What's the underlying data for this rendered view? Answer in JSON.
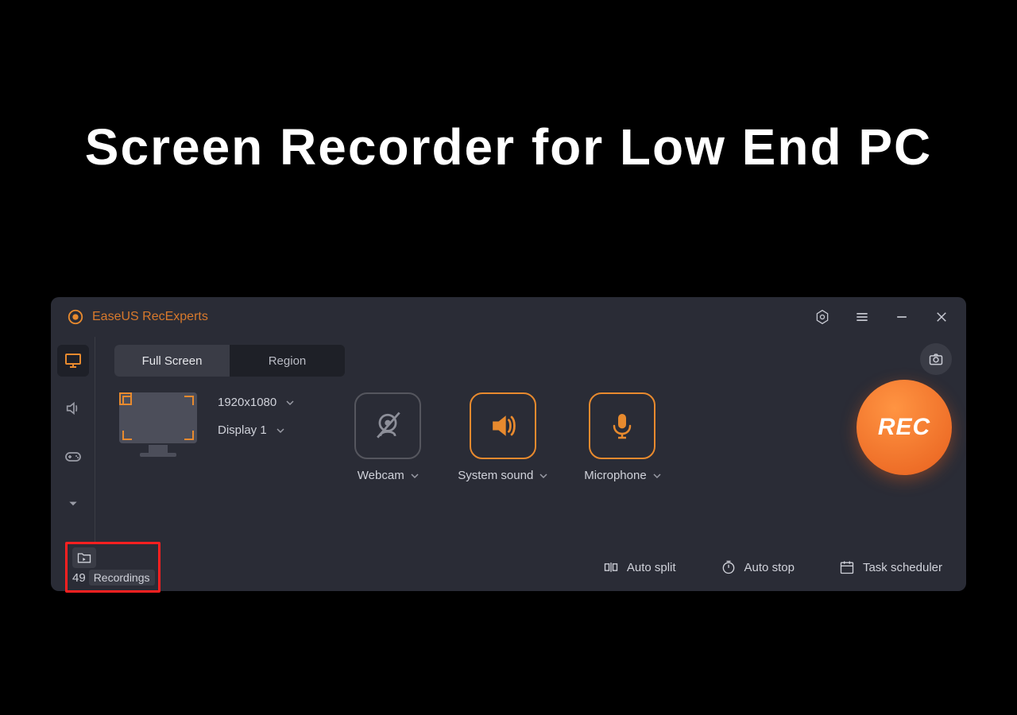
{
  "hero_title": "Screen Recorder for Low End PC",
  "app": {
    "name": "EaseUS RecExperts",
    "accent_color": "#e88a2e"
  },
  "tabs": {
    "full_screen": "Full Screen",
    "region": "Region"
  },
  "display": {
    "resolution": "1920x1080",
    "name": "Display 1"
  },
  "sources": {
    "webcam": "Webcam",
    "system_sound": "System sound",
    "microphone": "Microphone"
  },
  "rec_label": "REC",
  "footer": {
    "recordings_count": "49",
    "recordings_label": "Recordings",
    "auto_split": "Auto split",
    "auto_stop": "Auto stop",
    "task_scheduler": "Task scheduler"
  }
}
